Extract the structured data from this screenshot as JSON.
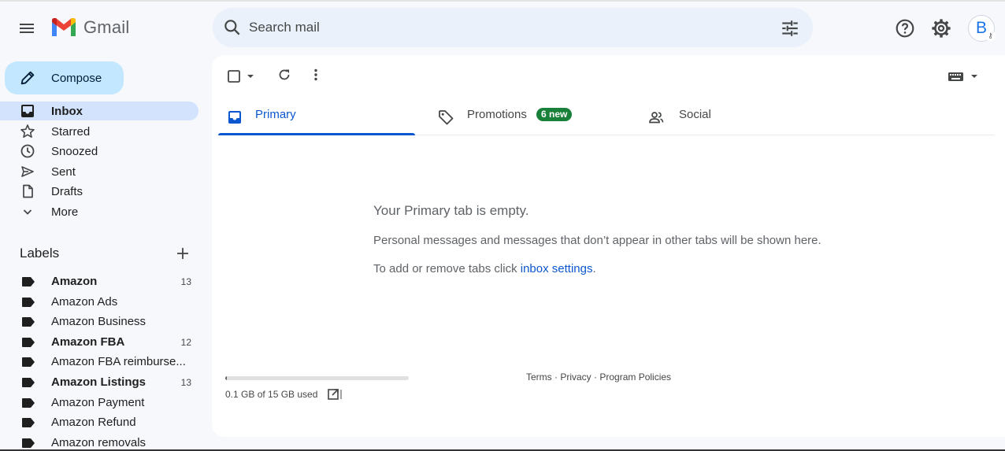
{
  "header": {
    "app_name": "Gmail",
    "search_placeholder": "Search mail",
    "avatar_letter": "B"
  },
  "compose": {
    "label": "Compose"
  },
  "nav": [
    {
      "label": "Inbox",
      "icon": "inbox-icon",
      "active": true
    },
    {
      "label": "Starred",
      "icon": "star-icon"
    },
    {
      "label": "Snoozed",
      "icon": "clock-icon"
    },
    {
      "label": "Sent",
      "icon": "send-icon"
    },
    {
      "label": "Drafts",
      "icon": "draft-icon"
    },
    {
      "label": "More",
      "icon": "chevron-down-icon"
    }
  ],
  "labels": {
    "title": "Labels",
    "items": [
      {
        "name": "Amazon",
        "count": "13",
        "bold": true
      },
      {
        "name": "Amazon Ads",
        "count": ""
      },
      {
        "name": "Amazon Business",
        "count": ""
      },
      {
        "name": "Amazon FBA",
        "count": "12",
        "bold": true
      },
      {
        "name": "Amazon FBA reimburse...",
        "count": ""
      },
      {
        "name": "Amazon Listings",
        "count": "13",
        "bold": true
      },
      {
        "name": "Amazon Payment",
        "count": ""
      },
      {
        "name": "Amazon Refund",
        "count": ""
      },
      {
        "name": "Amazon removals",
        "count": ""
      }
    ]
  },
  "tabs": [
    {
      "label": "Primary",
      "icon": "inbox-tab-icon",
      "active": true
    },
    {
      "label": "Promotions",
      "icon": "tag-icon",
      "badge": "6 new"
    },
    {
      "label": "Social",
      "icon": "people-icon"
    }
  ],
  "empty_state": {
    "title": "Your Primary tab is empty.",
    "description": "Personal messages and messages that don’t appear in other tabs will be shown here.",
    "hint_prefix": "To add or remove tabs click ",
    "hint_link": "inbox settings",
    "hint_suffix": "."
  },
  "storage": {
    "text": "0.1 GB of 15 GB used",
    "used_fraction": 0.007
  },
  "footer": {
    "terms": "Terms",
    "privacy": "Privacy",
    "policies": "Program Policies",
    "separator": " · "
  },
  "colors": {
    "background": "#f6f8fc",
    "compose_bg": "#c2e7ff",
    "active_nav_bg": "#d3e3fd",
    "search_bg": "#eaf1fb",
    "accent": "#0b57d0",
    "badge": "#188038"
  }
}
